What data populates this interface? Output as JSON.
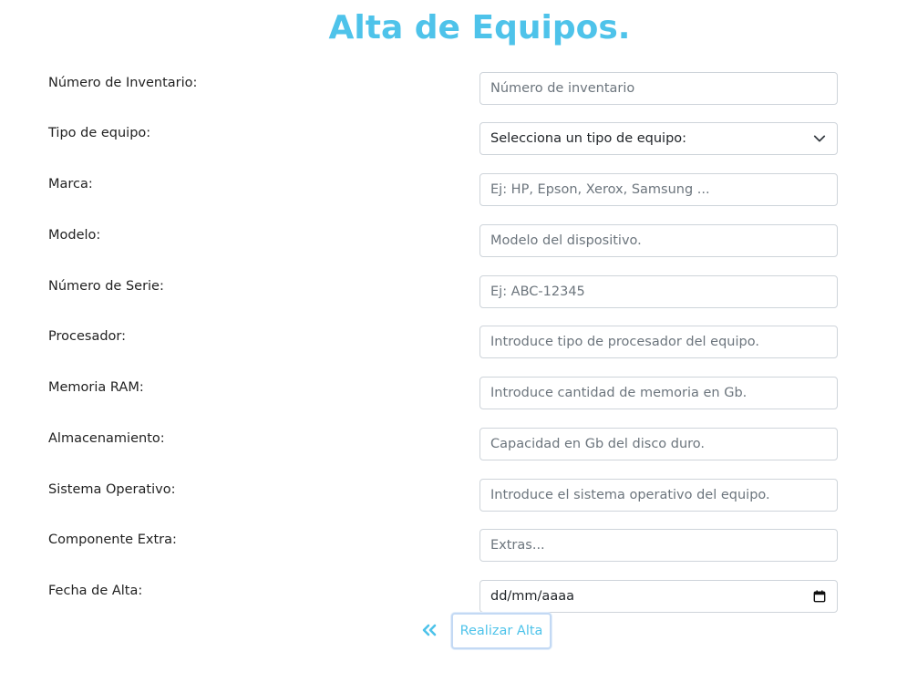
{
  "page": {
    "title": "Alta de Equipos."
  },
  "form": {
    "fields": [
      {
        "label": "Número de Inventario:",
        "placeholder": "Número de inventario",
        "value": ""
      },
      {
        "label": "Tipo de equipo:",
        "selected": "Selecciona un tipo de equipo:"
      },
      {
        "label": "Marca:",
        "placeholder": "Ej: HP, Epson, Xerox, Samsung ...",
        "value": ""
      },
      {
        "label": "Modelo:",
        "placeholder": "Modelo del dispositivo.",
        "value": ""
      },
      {
        "label": "Número de Serie:",
        "placeholder": "Ej: ABC-12345",
        "value": ""
      },
      {
        "label": "Procesador:",
        "placeholder": "Introduce tipo de procesador del equipo.",
        "value": ""
      },
      {
        "label": "Memoria RAM:",
        "placeholder": "Introduce cantidad de memoria en Gb.",
        "value": ""
      },
      {
        "label": "Almacenamiento:",
        "placeholder": "Capacidad en Gb del disco duro.",
        "value": ""
      },
      {
        "label": "Sistema Operativo:",
        "placeholder": "Introduce el sistema operativo del equipo.",
        "value": ""
      },
      {
        "label": "Componente Extra:",
        "placeholder": "Extras...",
        "value": ""
      },
      {
        "label": "Fecha de Alta:",
        "value": "dd/mm/aaaa"
      }
    ],
    "submit_label": "Realizar Alta",
    "back_icon": "double-chevron-left-icon"
  },
  "colors": {
    "accent": "#4ec3ea",
    "text": "#222222",
    "placeholder": "#6c757d",
    "border": "#ced4da",
    "button_border": "#c3d9f4"
  }
}
